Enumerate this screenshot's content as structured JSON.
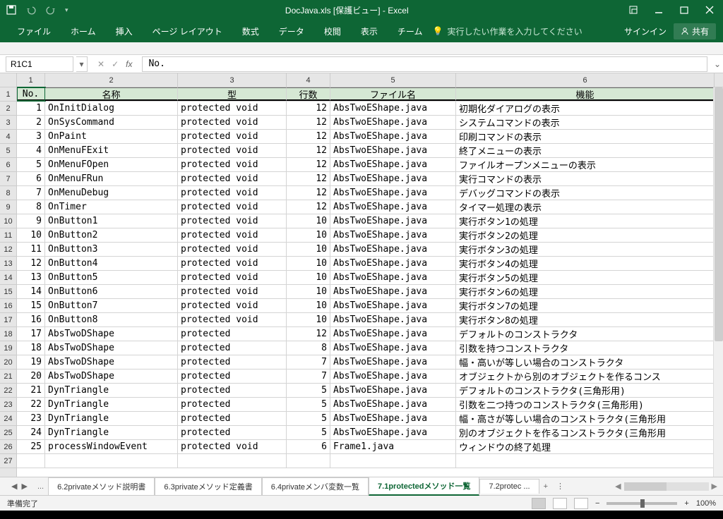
{
  "title": "DocJava.xls  [保護ビュー] - Excel",
  "ribbon": {
    "file": "ファイル",
    "home": "ホーム",
    "insert": "挿入",
    "layout": "ページ レイアウト",
    "formulas": "数式",
    "data": "データ",
    "review": "校閲",
    "view": "表示",
    "team": "チーム",
    "tellme": "実行したい作業を入力してください",
    "signin": "サインイン",
    "share": "共有"
  },
  "namebox": "R1C1",
  "formula": "No.",
  "col_headers": [
    "1",
    "2",
    "3",
    "4",
    "5",
    "6"
  ],
  "row_headers": [
    "1",
    "2",
    "3",
    "4",
    "5",
    "6",
    "7",
    "8",
    "9",
    "10",
    "11",
    "12",
    "13",
    "14",
    "15",
    "16",
    "17",
    "18",
    "19",
    "20",
    "21",
    "22",
    "23",
    "24",
    "25",
    "26",
    "27"
  ],
  "table_headers": [
    "No.",
    "名称",
    "型",
    "行数",
    "ファイル名",
    "機能"
  ],
  "rows": [
    {
      "no": "1",
      "name": "OnInitDialog",
      "type": "protected void",
      "lines": "12",
      "file": "AbsTwoEShape.java",
      "func": "初期化ダイアログの表示"
    },
    {
      "no": "2",
      "name": "OnSysCommand",
      "type": "protected void",
      "lines": "12",
      "file": "AbsTwoEShape.java",
      "func": "システムコマンドの表示"
    },
    {
      "no": "3",
      "name": "OnPaint",
      "type": "protected void",
      "lines": "12",
      "file": "AbsTwoEShape.java",
      "func": "印刷コマンドの表示"
    },
    {
      "no": "4",
      "name": "OnMenuFExit",
      "type": "protected void",
      "lines": "12",
      "file": "AbsTwoEShape.java",
      "func": "終了メニューの表示"
    },
    {
      "no": "5",
      "name": "OnMenuFOpen",
      "type": "protected void",
      "lines": "12",
      "file": "AbsTwoEShape.java",
      "func": "ファイルオープンメニューの表示"
    },
    {
      "no": "6",
      "name": "OnMenuFRun",
      "type": "protected void",
      "lines": "12",
      "file": "AbsTwoEShape.java",
      "func": "実行コマンドの表示"
    },
    {
      "no": "7",
      "name": "OnMenuDebug",
      "type": "protected void",
      "lines": "12",
      "file": "AbsTwoEShape.java",
      "func": "デバッグコマンドの表示"
    },
    {
      "no": "8",
      "name": "OnTimer",
      "type": "protected void",
      "lines": "12",
      "file": "AbsTwoEShape.java",
      "func": "タイマー処理の表示"
    },
    {
      "no": "9",
      "name": "OnButton1",
      "type": "protected void",
      "lines": "10",
      "file": "AbsTwoEShape.java",
      "func": "実行ボタン1の処理"
    },
    {
      "no": "10",
      "name": "OnButton2",
      "type": "protected void",
      "lines": "10",
      "file": "AbsTwoEShape.java",
      "func": "実行ボタン2の処理"
    },
    {
      "no": "11",
      "name": "OnButton3",
      "type": "protected void",
      "lines": "10",
      "file": "AbsTwoEShape.java",
      "func": "実行ボタン3の処理"
    },
    {
      "no": "12",
      "name": "OnButton4",
      "type": "protected void",
      "lines": "10",
      "file": "AbsTwoEShape.java",
      "func": "実行ボタン4の処理"
    },
    {
      "no": "13",
      "name": "OnButton5",
      "type": "protected void",
      "lines": "10",
      "file": "AbsTwoEShape.java",
      "func": "実行ボタン5の処理"
    },
    {
      "no": "14",
      "name": "OnButton6",
      "type": "protected void",
      "lines": "10",
      "file": "AbsTwoEShape.java",
      "func": "実行ボタン6の処理"
    },
    {
      "no": "15",
      "name": "OnButton7",
      "type": "protected void",
      "lines": "10",
      "file": "AbsTwoEShape.java",
      "func": "実行ボタン7の処理"
    },
    {
      "no": "16",
      "name": "OnButton8",
      "type": "protected void",
      "lines": "10",
      "file": "AbsTwoEShape.java",
      "func": "実行ボタン8の処理"
    },
    {
      "no": "17",
      "name": "AbsTwoDShape",
      "type": "protected",
      "lines": "12",
      "file": "AbsTwoEShape.java",
      "func": "デフォルトのコンストラクタ"
    },
    {
      "no": "18",
      "name": "AbsTwoDShape",
      "type": "protected",
      "lines": "8",
      "file": "AbsTwoEShape.java",
      "func": "引数を持つコンストラクタ"
    },
    {
      "no": "19",
      "name": "AbsTwoDShape",
      "type": "protected",
      "lines": "7",
      "file": "AbsTwoEShape.java",
      "func": "幅・高いが等しい場合のコンストラクタ"
    },
    {
      "no": "20",
      "name": "AbsTwoDShape",
      "type": "protected",
      "lines": "7",
      "file": "AbsTwoEShape.java",
      "func": "オブジェクトから別のオブジェクトを作るコンス"
    },
    {
      "no": "21",
      "name": "DynTriangle",
      "type": "protected",
      "lines": "5",
      "file": "AbsTwoEShape.java",
      "func": "デフォルトのコンストラクタ(三角形用)"
    },
    {
      "no": "22",
      "name": "DynTriangle",
      "type": "protected",
      "lines": "5",
      "file": "AbsTwoEShape.java",
      "func": "引数を二つ持つのコンストラクタ(三角形用)"
    },
    {
      "no": "23",
      "name": "DynTriangle",
      "type": "protected",
      "lines": "5",
      "file": "AbsTwoEShape.java",
      "func": "幅・高さが等しい場合のコンストラクタ(三角形用"
    },
    {
      "no": "24",
      "name": "DynTriangle",
      "type": "protected",
      "lines": "5",
      "file": "AbsTwoEShape.java",
      "func": "別のオブジェクトを作るコンストラクタ(三角形用"
    },
    {
      "no": "25",
      "name": "processWindowEvent",
      "type": "protected void",
      "lines": "6",
      "file": "Frame1.java",
      "func": "ウィンドウの終了処理"
    }
  ],
  "tabs": {
    "dots": "...",
    "t1": "6.2privateメソッド説明書",
    "t2": "6.3privateメソッド定義書",
    "t3": "6.4privateメンバ変数一覧",
    "t4": "7.1protectedメソッド一覧",
    "t5": "7.2protec ...",
    "plus": "+"
  },
  "status": {
    "ready": "準備完了",
    "zoom": "100%"
  }
}
